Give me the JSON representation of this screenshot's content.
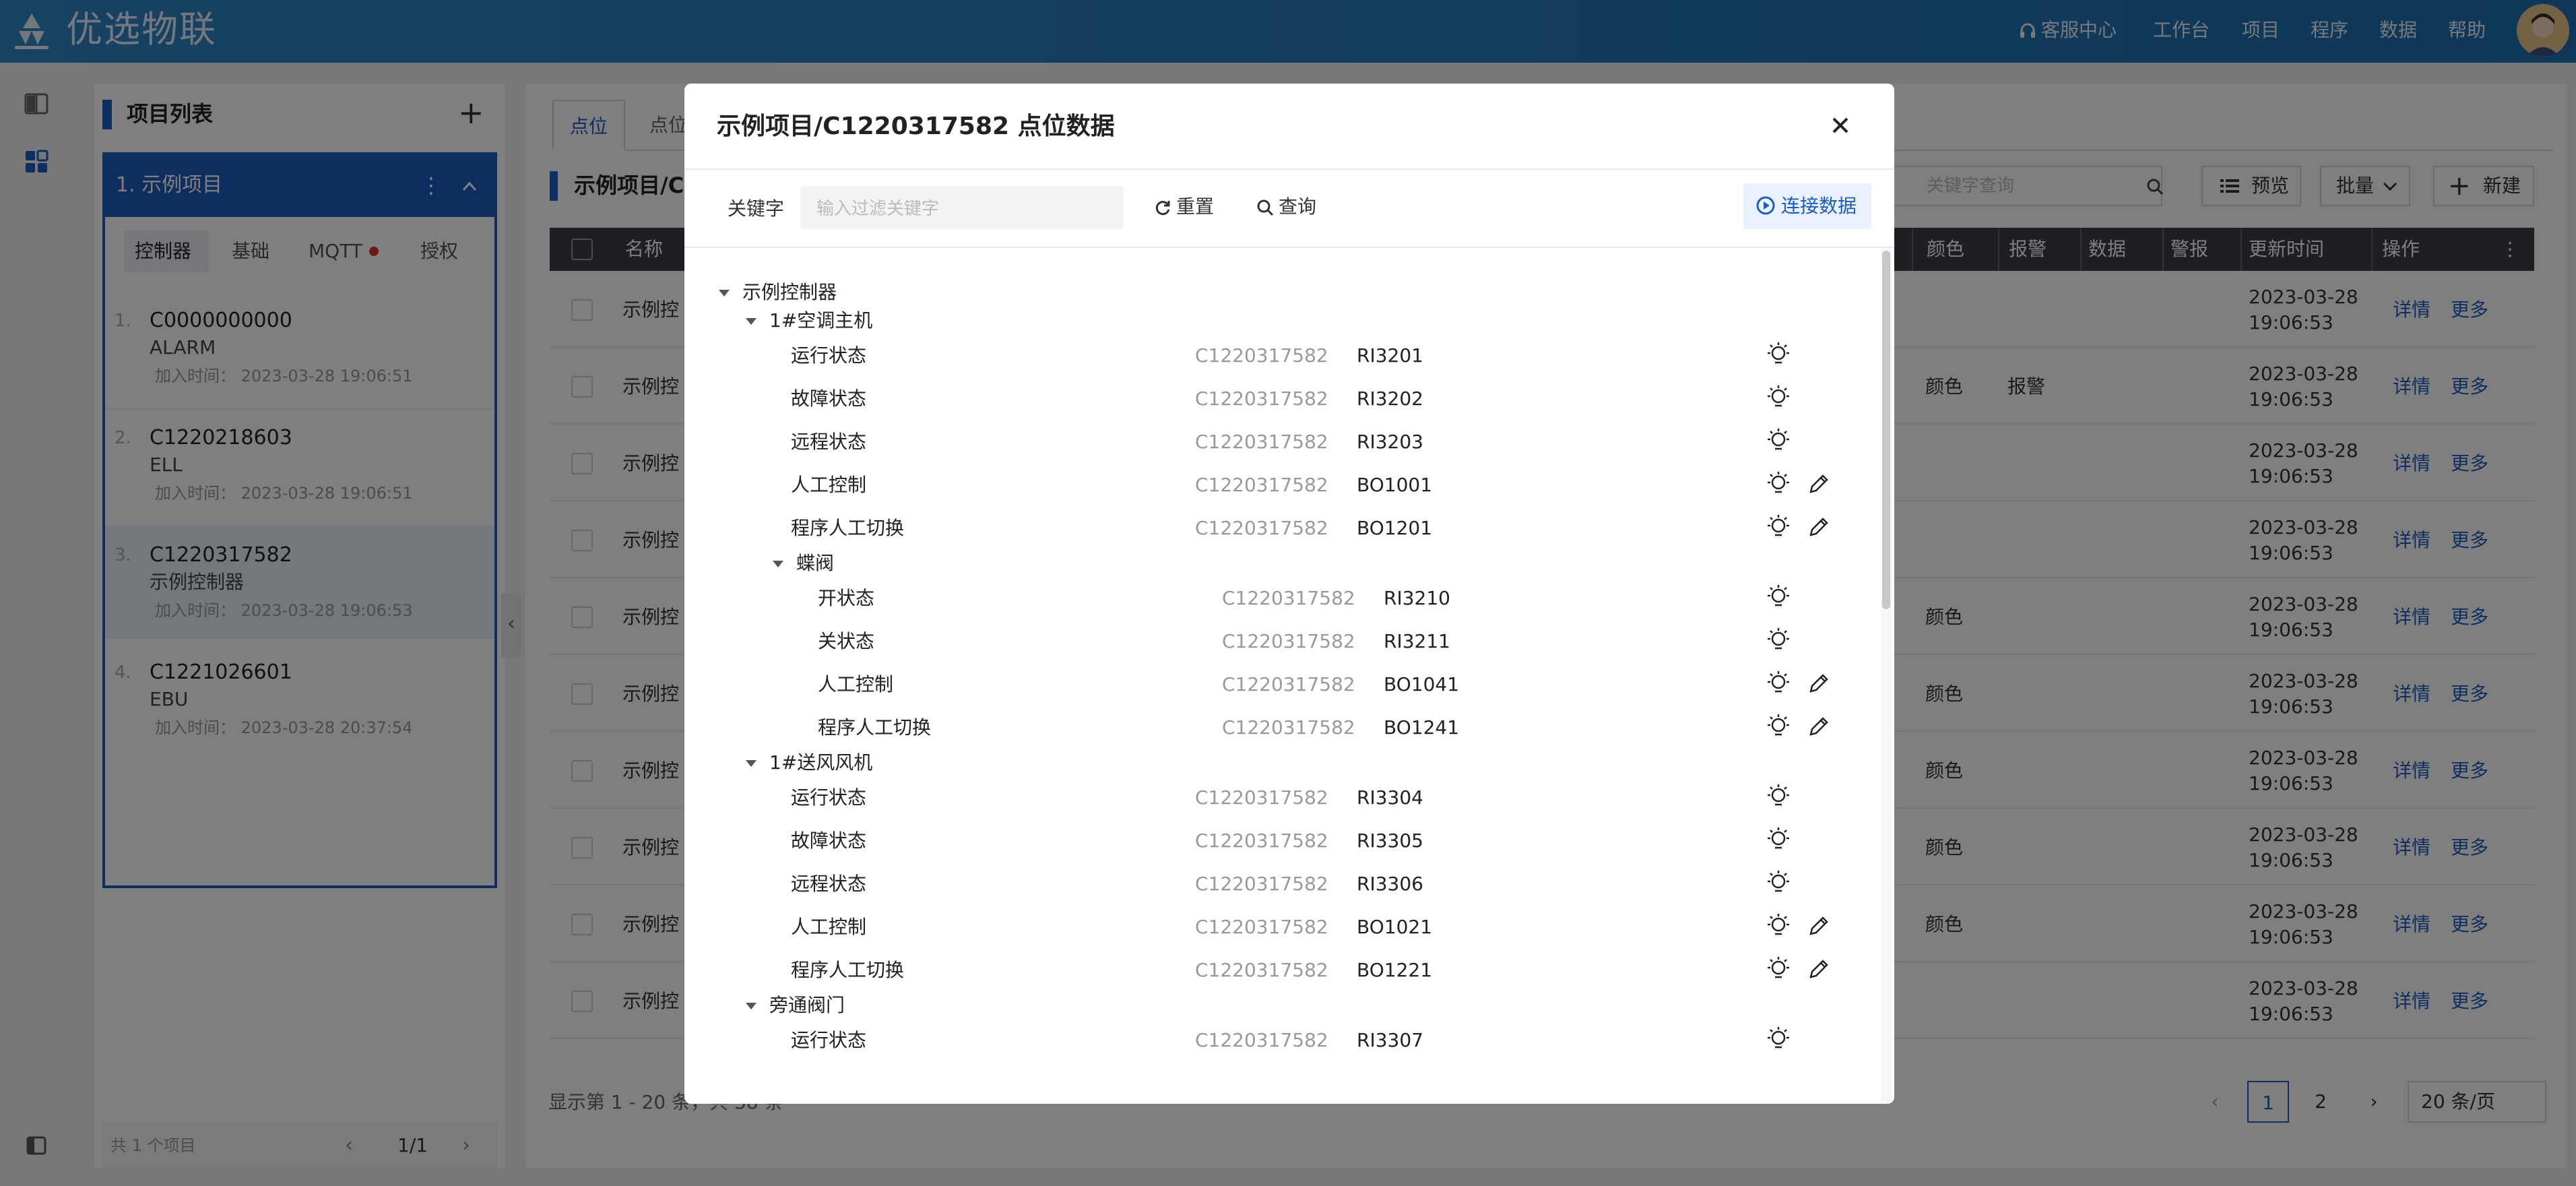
{
  "header": {
    "app_name": "优选物联",
    "nav": [
      "客服中心",
      "工作台",
      "项目",
      "程序",
      "数据",
      "帮助"
    ]
  },
  "project_panel": {
    "title": "项目列表",
    "add_icon": "plus-icon",
    "current_project": "1. 示例项目",
    "tabs": [
      "控制器",
      "基础",
      "MQTT",
      "授权"
    ],
    "items": [
      {
        "num": "1.",
        "id": "C0000000000",
        "name": "ALARM",
        "time": "加入时间： 2023-03-28 19:06:51"
      },
      {
        "num": "2.",
        "id": "C1220218603",
        "name": "ELL",
        "time": "加入时间： 2023-03-28 19:06:51"
      },
      {
        "num": "3.",
        "id": "C1220317582",
        "name": "示例控制器",
        "time": "加入时间： 2023-03-28 19:06:53"
      },
      {
        "num": "4.",
        "id": "C1221026601",
        "name": "EBU",
        "time": "加入时间： 2023-03-28 20:37:54"
      }
    ],
    "footer_total": "共 1 个项目",
    "pagination": "1/1"
  },
  "main": {
    "tabs": [
      "点位",
      "点位"
    ],
    "breadcrumb": "示例项目/C",
    "search_placeholder": "关键字查询",
    "buttons": {
      "preview": "预览",
      "batch": "批量",
      "new": "新建"
    },
    "columns": {
      "name": "名称",
      "color": "颜色",
      "alarm": "报警",
      "data": "数据",
      "warn": "警报",
      "updated": "更新时间",
      "ops": "操作"
    },
    "rows": [
      {
        "name": "示例控",
        "color": "",
        "alarm": "",
        "date": "2023-03-28",
        "time": "19:06:53"
      },
      {
        "name": "示例控",
        "color": "颜色",
        "alarm": "报警",
        "date": "2023-03-28",
        "time": "19:06:53"
      },
      {
        "name": "示例控",
        "color": "",
        "alarm": "",
        "date": "2023-03-28",
        "time": "19:06:53"
      },
      {
        "name": "示例控",
        "color": "",
        "alarm": "",
        "date": "2023-03-28",
        "time": "19:06:53"
      },
      {
        "name": "示例控",
        "color": "颜色",
        "alarm": "",
        "date": "2023-03-28",
        "time": "19:06:53"
      },
      {
        "name": "示例控",
        "color": "颜色",
        "alarm": "",
        "date": "2023-03-28",
        "time": "19:06:53"
      },
      {
        "name": "示例控",
        "color": "颜色",
        "alarm": "",
        "date": "2023-03-28",
        "time": "19:06:53"
      },
      {
        "name": "示例控",
        "color": "颜色",
        "alarm": "",
        "date": "2023-03-28",
        "time": "19:06:53"
      },
      {
        "name": "示例控",
        "color": "颜色",
        "alarm": "",
        "date": "2023-03-28",
        "time": "19:06:53"
      },
      {
        "name": "示例控",
        "color": "",
        "alarm": "",
        "date": "2023-03-28",
        "time": "19:06:53"
      }
    ],
    "row_action_detail": "详情",
    "row_action_more": "更多",
    "page_info": "显示第 1 - 20 条，共 38 条",
    "pages": [
      "1",
      "2"
    ],
    "page_size": "20 条/页"
  },
  "modal": {
    "title": "示例项目/C1220317582 点位数据",
    "keyword_label": "关键字",
    "keyword_placeholder": "输入过滤关键字",
    "reset_label": "重置",
    "query_label": "查询",
    "connect_label": "连接数据",
    "tree": [
      {
        "type": "group",
        "level": 0,
        "label": "示例控制器"
      },
      {
        "type": "group",
        "level": 1,
        "label": "1#空调主机"
      },
      {
        "type": "leaf",
        "level": 2,
        "label": "运行状态",
        "cid": "C1220317582",
        "code": "RI3201",
        "editable": false
      },
      {
        "type": "leaf",
        "level": 2,
        "label": "故障状态",
        "cid": "C1220317582",
        "code": "RI3202",
        "editable": false
      },
      {
        "type": "leaf",
        "level": 2,
        "label": "远程状态",
        "cid": "C1220317582",
        "code": "RI3203",
        "editable": false
      },
      {
        "type": "leaf",
        "level": 2,
        "label": "人工控制",
        "cid": "C1220317582",
        "code": "BO1001",
        "editable": true
      },
      {
        "type": "leaf",
        "level": 2,
        "label": "程序人工切换",
        "cid": "C1220317582",
        "code": "BO1201",
        "editable": true
      },
      {
        "type": "group",
        "level": 2,
        "label": "蝶阀"
      },
      {
        "type": "leaf",
        "level": 3,
        "label": "开状态",
        "cid": "C1220317582",
        "code": "RI3210",
        "editable": false
      },
      {
        "type": "leaf",
        "level": 3,
        "label": "关状态",
        "cid": "C1220317582",
        "code": "RI3211",
        "editable": false
      },
      {
        "type": "leaf",
        "level": 3,
        "label": "人工控制",
        "cid": "C1220317582",
        "code": "BO1041",
        "editable": true
      },
      {
        "type": "leaf",
        "level": 3,
        "label": "程序人工切换",
        "cid": "C1220317582",
        "code": "BO1241",
        "editable": true
      },
      {
        "type": "group",
        "level": 1,
        "label": "1#送风风机"
      },
      {
        "type": "leaf",
        "level": 2,
        "label": "运行状态",
        "cid": "C1220317582",
        "code": "RI3304",
        "editable": false
      },
      {
        "type": "leaf",
        "level": 2,
        "label": "故障状态",
        "cid": "C1220317582",
        "code": "RI3305",
        "editable": false
      },
      {
        "type": "leaf",
        "level": 2,
        "label": "远程状态",
        "cid": "C1220317582",
        "code": "RI3306",
        "editable": false
      },
      {
        "type": "leaf",
        "level": 2,
        "label": "人工控制",
        "cid": "C1220317582",
        "code": "BO1021",
        "editable": true
      },
      {
        "type": "leaf",
        "level": 2,
        "label": "程序人工切换",
        "cid": "C1220317582",
        "code": "BO1221",
        "editable": true
      },
      {
        "type": "group",
        "level": 1,
        "label": "旁通阀门"
      },
      {
        "type": "leaf",
        "level": 2,
        "label": "运行状态",
        "cid": "C1220317582",
        "code": "RI3307",
        "editable": false
      }
    ]
  },
  "colors": {
    "accent": "#1d5dbf",
    "header": "#2f84c3",
    "table_header": "#3a3f48"
  }
}
